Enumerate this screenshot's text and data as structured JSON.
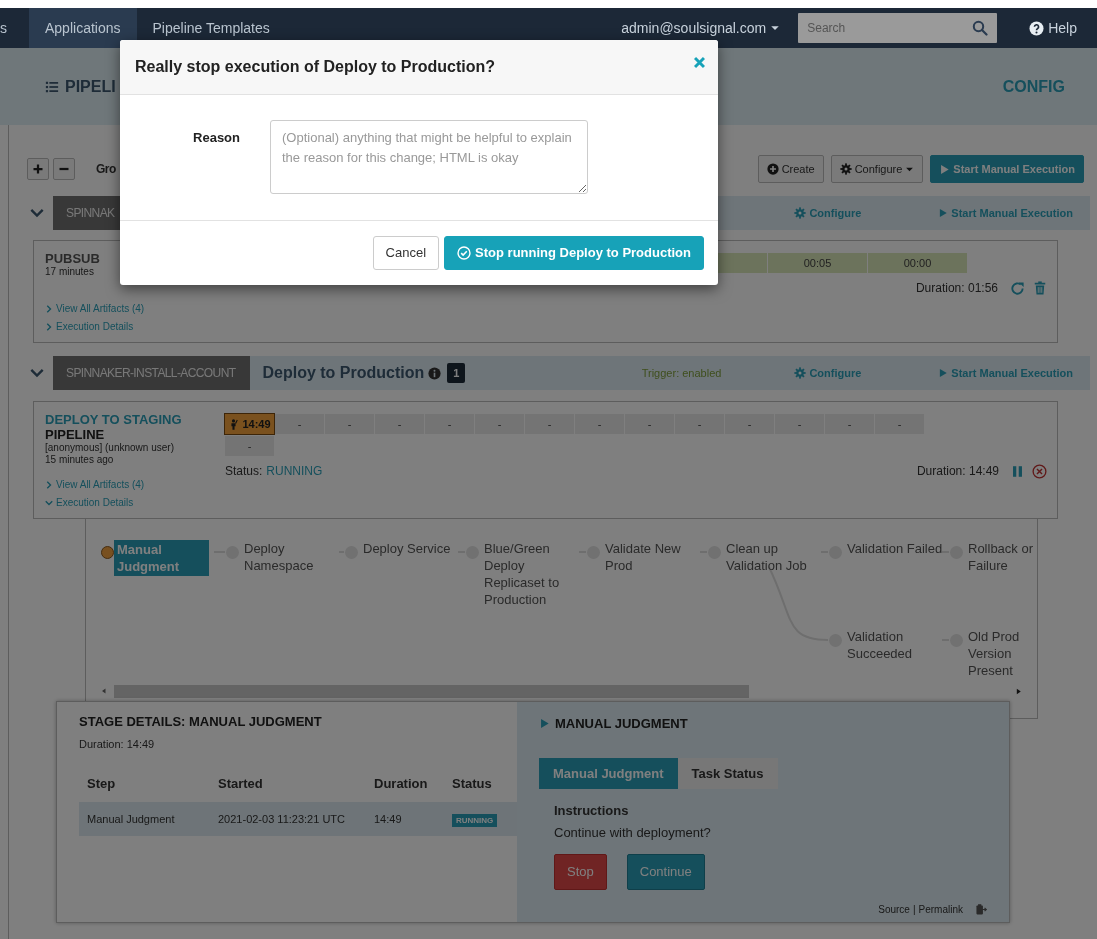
{
  "navbar": {
    "items": [
      {
        "label": "s",
        "selected": false
      },
      {
        "label": "Applications",
        "selected": true
      },
      {
        "label": "Pipeline Templates",
        "selected": false
      }
    ],
    "user": "admin@soulsignal.com",
    "search": {
      "placeholder": "Search"
    },
    "help": "Help"
  },
  "header": {
    "title": "PIPELI",
    "config": "CONFIG"
  },
  "toolbar": {
    "group_label": "Gro",
    "buttons": [
      {
        "label": "Create",
        "kind": "create"
      },
      {
        "label": "Configure",
        "kind": "menu"
      },
      {
        "label": "Start Manual Execution",
        "kind": "start"
      }
    ]
  },
  "groups": [
    {
      "expanded": true,
      "account": "SPINNAK",
      "configure": "Configure",
      "start": "Start Manual Execution",
      "executions": [
        {
          "kind": "succeeded",
          "title": "PUBSUB",
          "time": "17 minutes",
          "links": [
            {
              "label": "View All Artifacts (4)",
              "expanded": false
            },
            {
              "label": "Execution Details",
              "expanded": false
            }
          ],
          "stages": [
            {
              "kind": "succeeded"
            },
            {
              "kind": "succeeded",
              "label": "00:05"
            },
            {
              "kind": "succeeded",
              "label": "00:00"
            }
          ],
          "duration": "Duration: 01:56"
        }
      ]
    },
    {
      "expanded": true,
      "account": "SPINNAKER-INSTALL-ACCOUNT",
      "name": "Deploy to Production",
      "badge": "1",
      "trigger": "Trigger: enabled",
      "configure": "Configure",
      "start": "Start Manual Execution",
      "executions": [
        {
          "kind": "running",
          "title": "DEPLOY TO STAGING",
          "type": "PIPELINE",
          "user": "[anonymous] (unknown user)",
          "time": "15 minutes ago",
          "links": [
            {
              "label": "View All Artifacts (4)",
              "expanded": false
            },
            {
              "label": "Execution Details",
              "expanded": true
            }
          ],
          "stages": [
            {
              "kind": "running",
              "label": "14:49"
            },
            {
              "kind": "waiting",
              "label": "-"
            },
            {
              "kind": "waiting",
              "label": "-"
            },
            {
              "kind": "waiting",
              "label": "-"
            },
            {
              "kind": "waiting",
              "label": "-"
            },
            {
              "kind": "waiting",
              "label": "-"
            },
            {
              "kind": "waiting",
              "label": "-"
            },
            {
              "kind": "waiting",
              "label": "-"
            },
            {
              "kind": "waiting",
              "label": "-"
            },
            {
              "kind": "waiting",
              "label": "-"
            },
            {
              "kind": "waiting",
              "label": "-"
            },
            {
              "kind": "waiting",
              "label": "-"
            },
            {
              "kind": "waiting",
              "label": "-"
            },
            {
              "kind": "waiting",
              "label": "-"
            },
            {
              "kind": "waiting",
              "label": "-"
            }
          ],
          "status_label": "Status:",
          "status_value": "RUNNING",
          "duration": "Duration: 14:49",
          "details": {
            "nodes": [
              {
                "label": "Manual Judgment",
                "selected": true,
                "kind": "running"
              },
              {
                "label": "Deploy Namespace",
                "selected": false,
                "kind": "waiting"
              },
              {
                "label": "Deploy Service",
                "selected": false,
                "kind": "waiting"
              },
              {
                "label": "Blue/Green Deploy Replicaset to Production",
                "selected": false,
                "kind": "waiting"
              },
              {
                "label": "Validate New Prod",
                "selected": false,
                "kind": "waiting"
              },
              {
                "label": "Clean up Validation Job",
                "selected": false,
                "kind": "waiting"
              },
              {
                "label": "Validation Failed",
                "selected": false,
                "kind": "waiting"
              },
              {
                "label": "Rollback or Failure",
                "selected": false,
                "kind": "waiting"
              },
              {
                "label": "Validation Succeeded",
                "selected": false,
                "kind": "waiting"
              },
              {
                "label": "Old Prod Version Present",
                "selected": false,
                "kind": "waiting"
              }
            ],
            "stage": {
              "title": "STAGE DETAILS: MANUAL JUDGMENT",
              "duration": "Duration: 14:49",
              "columns": [
                "Step",
                "Started",
                "Duration",
                "Status"
              ],
              "rows": [
                {
                  "selected": true,
                  "cells": [
                    "Manual Judgment",
                    "2021-02-03 11:23:21 UTC",
                    "14:49"
                  ],
                  "status": "RUNNING"
                }
              ]
            },
            "judgment": {
              "title": "MANUAL JUDGMENT",
              "tabs": [
                {
                  "label": "Manual Judgment",
                  "selected": true
                },
                {
                  "label": "Task Status",
                  "selected": false
                }
              ],
              "heading": "Instructions",
              "text": "Continue with deployment?",
              "buttons": [
                {
                  "label": "Stop",
                  "kind": "danger"
                },
                {
                  "label": "Continue",
                  "kind": "primary"
                }
              ],
              "source": "Source",
              "separator": "|",
              "permalink": "Permalink"
            }
          }
        }
      ]
    }
  ],
  "modal": {
    "title": "Really stop execution of Deploy to Production?",
    "reason_label": "Reason",
    "reason": {
      "placeholder": "(Optional) anything that might be helpful to explain the reason for this change; HTML is okay"
    },
    "buttons": [
      {
        "label": "Cancel",
        "kind": "secondary"
      },
      {
        "label": "Stop running Deploy to Production",
        "kind": "primary"
      }
    ]
  }
}
